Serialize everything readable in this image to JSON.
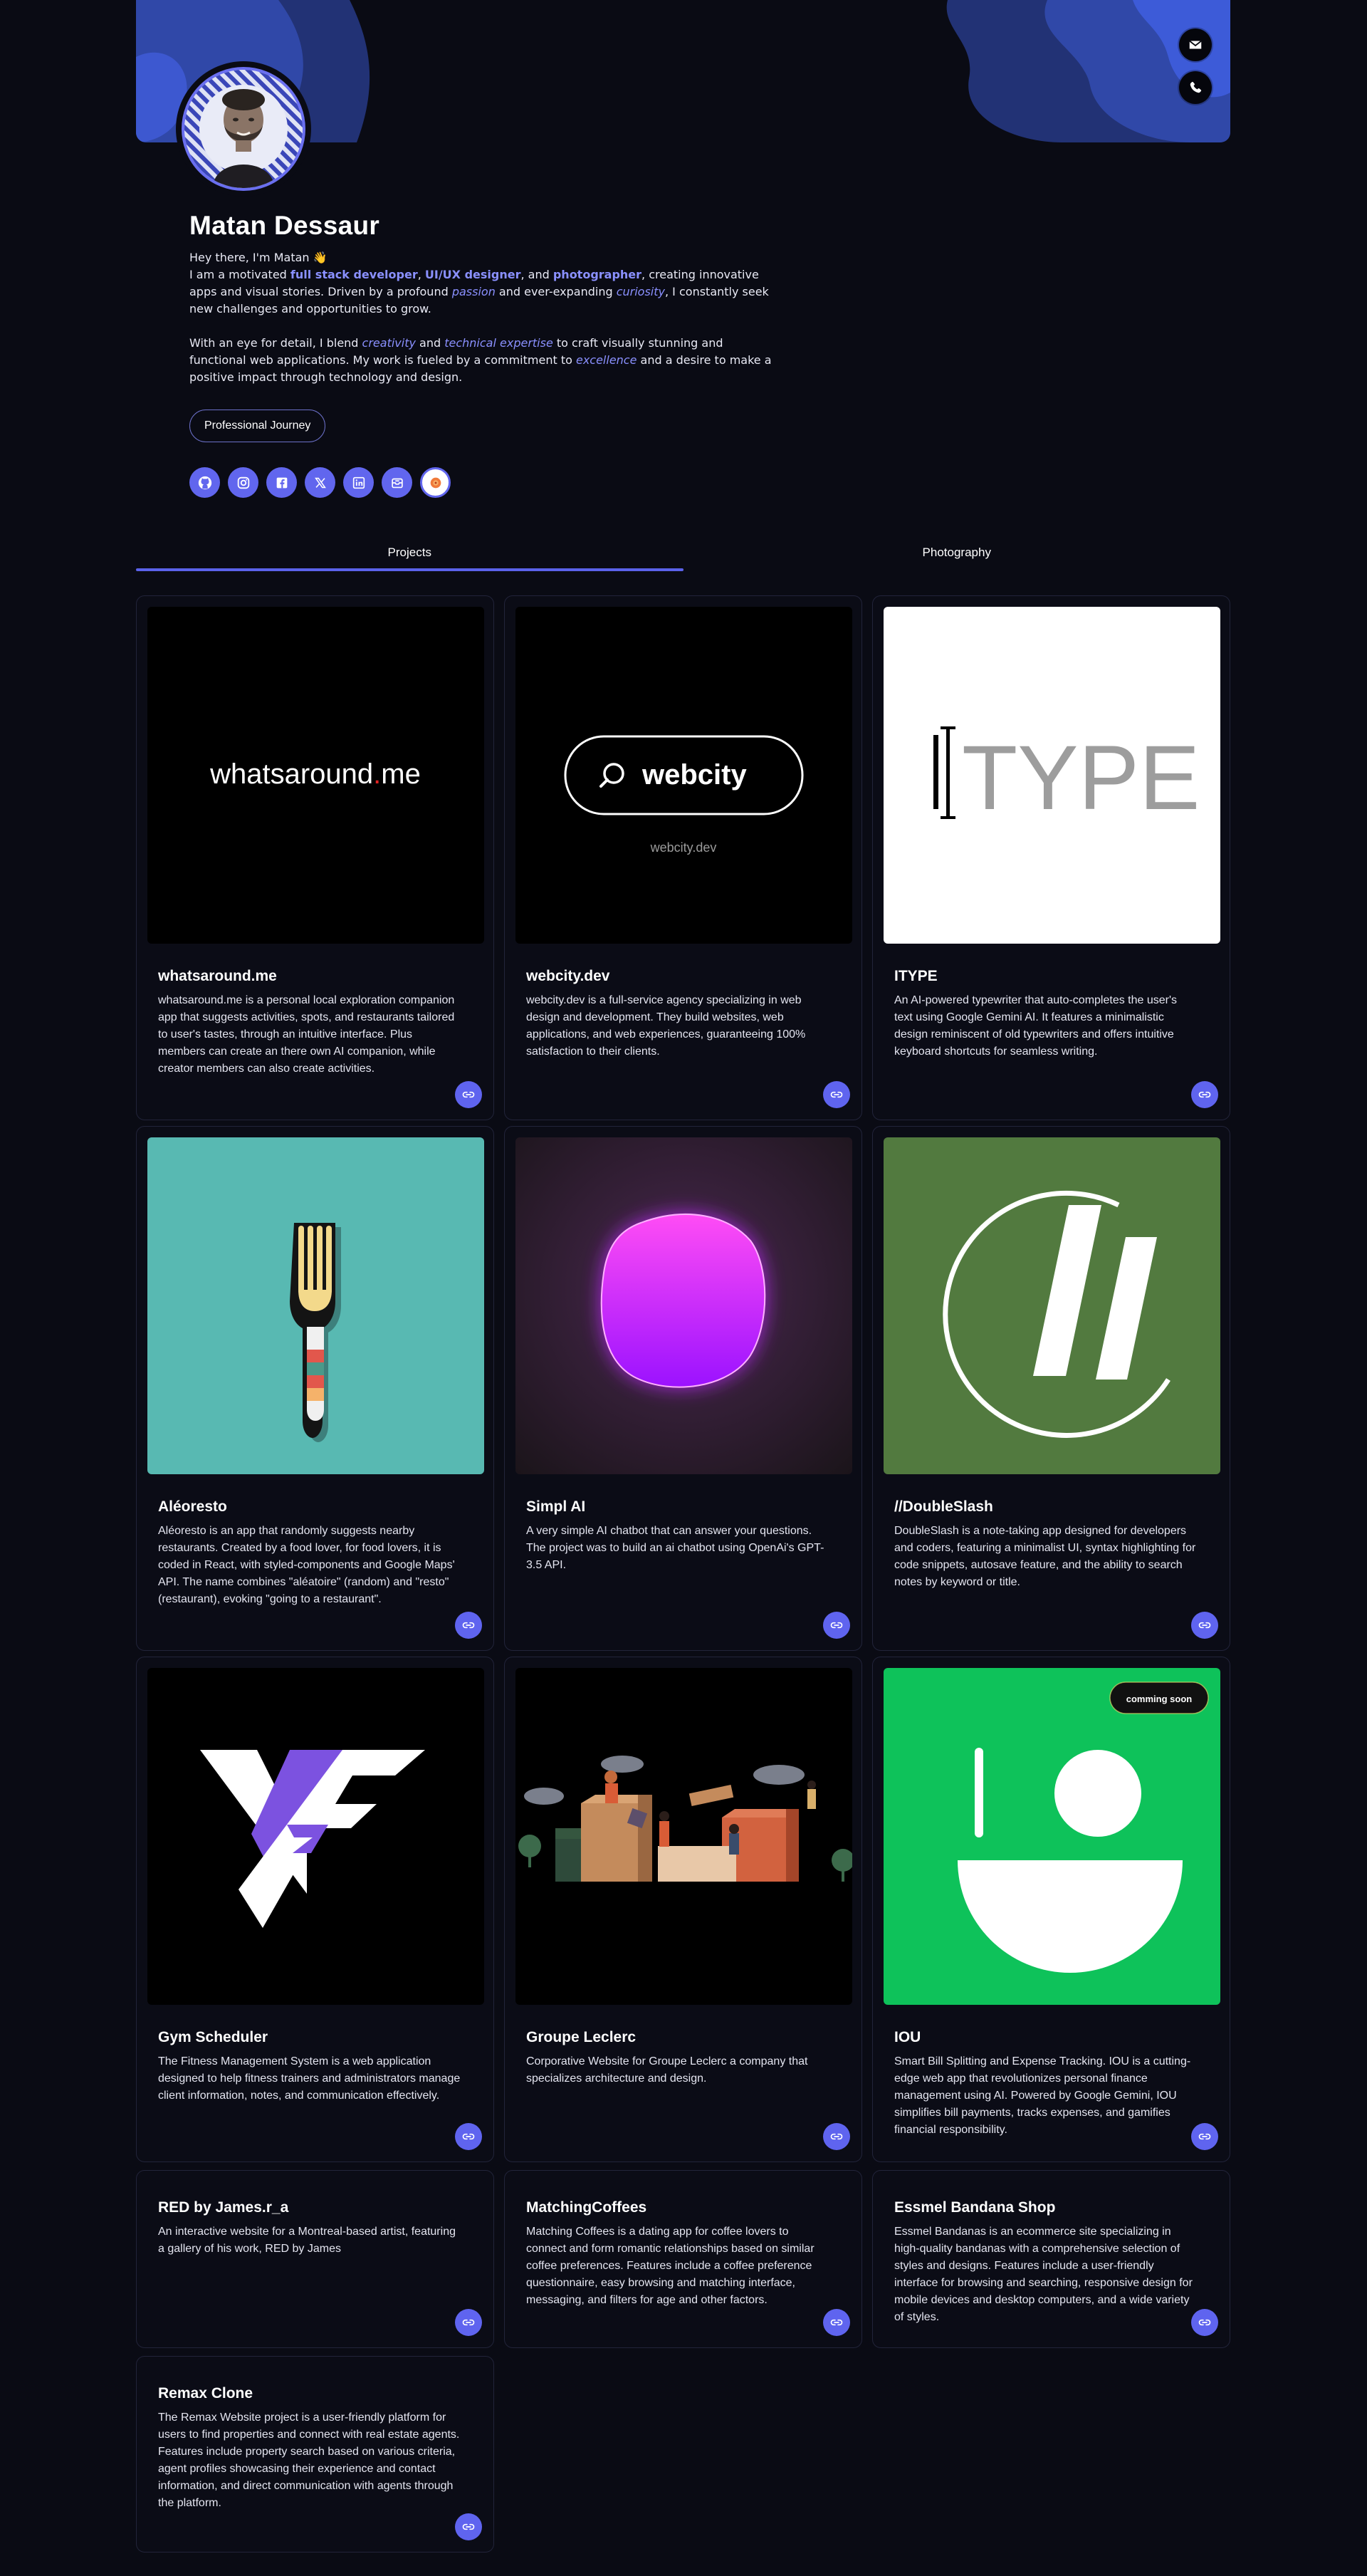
{
  "profile": {
    "name": "Matan Dessaur",
    "greeting": "Hey there, I'm Matan",
    "wave_emoji": "👋",
    "bio1": {
      "pre": "I am a motivated ",
      "role1": "full stack developer",
      "sep1": ", ",
      "role2": "UI/UX designer",
      "sep2": ", and ",
      "role3": "photographer",
      "mid": ", creating innovative apps and visual stories. Driven by a profound ",
      "word1": "passion",
      "mid2": " and ever-expanding ",
      "word2": "curiosity",
      "post": ", I constantly seek new challenges and opportunities to grow."
    },
    "bio2": {
      "pre": "With an eye for detail, I blend ",
      "word1": "creativity",
      "mid1": " and ",
      "word2": "technical expertise",
      "mid2": " to craft visually stunning and functional web applications. My work is fueled by a commitment to ",
      "word3": "excellence",
      "post": " and a desire to make a positive impact through technology and design."
    },
    "journey_button": "Professional Journey",
    "social_icons": [
      "github-icon",
      "instagram-icon",
      "facebook-icon",
      "x-icon",
      "linkedin-icon",
      "mail-box-icon",
      "photo-app-icon"
    ]
  },
  "contact": {
    "icons": [
      "mail-icon",
      "phone-icon"
    ]
  },
  "tabs": [
    {
      "label": "Projects",
      "active": true
    },
    {
      "label": "Photography",
      "active": false
    }
  ],
  "projects": [
    {
      "title": "whatsaround.me",
      "thumb_text": "whatsaround",
      "thumb_dot": ".",
      "thumb_tld": "me",
      "description": "whatsaround.me is a personal local exploration companion app that suggests activities, spots, and restaurants tailored to user's tastes, through an intuitive interface. Plus members can create an there own AI companion, while creator members can also create activities."
    },
    {
      "title": "webcity.dev",
      "thumb_text": "webcity",
      "thumb_sub": "webcity.dev",
      "description": "webcity.dev is a full-service agency specializing in web design and development. They build websites, web applications, and web experiences, guaranteeing 100% satisfaction to their clients."
    },
    {
      "title": "ITYPE",
      "thumb_text": "TYPE",
      "description": "An AI-powered typewriter that auto-completes the user's text using Google Gemini AI. It features a minimalistic design reminiscent of old typewriters and offers intuitive keyboard shortcuts for seamless writing."
    },
    {
      "title": "Aléoresto",
      "description": "Aléoresto is an app that randomly suggests nearby restaurants. Created by a food lover, for food lovers, it is coded in React, with styled-components and Google Maps' API. The name combines \"aléatoire\" (random) and \"resto\" (restaurant), evoking \"going to a restaurant\"."
    },
    {
      "title": "Simpl AI",
      "description": "A very simple AI chatbot that can answer your questions. The project was to build an ai chatbot using OpenAi's GPT-3.5 API."
    },
    {
      "title": "//DoubleSlash",
      "description": "DoubleSlash is a note-taking app designed for developers and coders, featuring a minimalist UI, syntax highlighting for code snippets, autosave feature, and the ability to search notes by keyword or title."
    },
    {
      "title": "Gym Scheduler",
      "description": "The Fitness Management System is a web application designed to help fitness trainers and administrators manage client information, notes, and communication effectively."
    },
    {
      "title": "Groupe Leclerc",
      "description": "Corporative Website for Groupe Leclerc a company that specializes architecture and design."
    },
    {
      "title": "IOU",
      "badge": "comming soon",
      "description": "Smart Bill Splitting and Expense Tracking. IOU is a cutting-edge web app that revolutionizes personal finance management using AI. Powered by Google Gemini, IOU simplifies bill payments, tracks expenses, and gamifies financial responsibility."
    },
    {
      "title": "RED by James.r_a",
      "description": "An interactive website for a Montreal-based artist, featuring a gallery of his work, RED by James"
    },
    {
      "title": "MatchingCoffees",
      "description": "Matching Coffees is a dating app for coffee lovers to connect and form romantic relationships based on similar coffee preferences. Features include a coffee preference questionnaire, easy browsing and matching interface, messaging, and filters for age and other factors."
    },
    {
      "title": "Essmel Bandana Shop",
      "description": "Essmel Bandanas is an ecommerce site specializing in high-quality bandanas with a comprehensive selection of styles and designs. Features include a user-friendly interface for browsing and searching, responsive design for mobile devices and desktop computers, and a wide variety of styles."
    },
    {
      "title": "Remax Clone",
      "description": "The Remax Website project is a user-friendly platform for users to find properties and connect with real estate agents. Features include property search based on various criteria, agent profiles showcasing their experience and contact information, and direct communication with agents through the platform."
    }
  ],
  "colors": {
    "accent": "#5f64ef",
    "background": "#0a0b14",
    "card_border": "#22243a",
    "highlight": "#8a90ff"
  },
  "link_icon": "link-icon"
}
